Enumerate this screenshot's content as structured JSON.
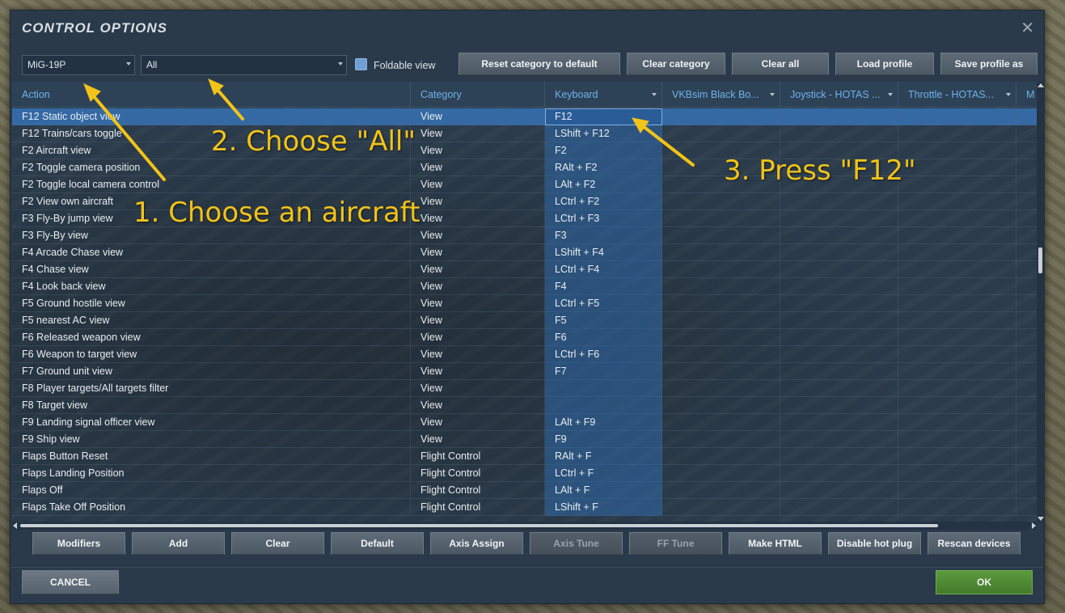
{
  "window": {
    "title": "CONTROL OPTIONS",
    "close_glyph": "✕"
  },
  "toolbar": {
    "aircraft_value": "MiG-19P",
    "category_value": "All",
    "foldable_label": "Foldable view",
    "buttons": [
      "Reset category to default",
      "Clear category",
      "Clear all",
      "Load profile",
      "Save profile as"
    ]
  },
  "grid": {
    "columns": [
      "Action",
      "Category",
      "Keyboard",
      "VKBsim Black Bo...",
      "Joystick - HOTAS ...",
      "Throttle - HOTAS...",
      "M"
    ],
    "rows": [
      {
        "action": "F12 Static object view",
        "category": "View",
        "keyboard": "F12",
        "selected": true
      },
      {
        "action": "F12 Trains/cars toggle",
        "category": "View",
        "keyboard": "LShift + F12"
      },
      {
        "action": "F2 Aircraft view",
        "category": "View",
        "keyboard": "F2"
      },
      {
        "action": "F2 Toggle camera position",
        "category": "View",
        "keyboard": "RAlt + F2"
      },
      {
        "action": "F2 Toggle local camera control",
        "category": "View",
        "keyboard": "LAlt + F2"
      },
      {
        "action": "F2 View own aircraft",
        "category": "View",
        "keyboard": "LCtrl + F2"
      },
      {
        "action": "F3 Fly-By jump view",
        "category": "View",
        "keyboard": "LCtrl + F3"
      },
      {
        "action": "F3 Fly-By view",
        "category": "View",
        "keyboard": "F3"
      },
      {
        "action": "F4 Arcade Chase view",
        "category": "View",
        "keyboard": "LShift + F4"
      },
      {
        "action": "F4 Chase view",
        "category": "View",
        "keyboard": "LCtrl + F4"
      },
      {
        "action": "F4 Look back view",
        "category": "View",
        "keyboard": "F4"
      },
      {
        "action": "F5 Ground hostile view",
        "category": "View",
        "keyboard": "LCtrl + F5"
      },
      {
        "action": "F5 nearest AC view",
        "category": "View",
        "keyboard": "F5"
      },
      {
        "action": "F6 Released weapon view",
        "category": "View",
        "keyboard": "F6"
      },
      {
        "action": "F6 Weapon to target view",
        "category": "View",
        "keyboard": "LCtrl + F6"
      },
      {
        "action": "F7 Ground unit view",
        "category": "View",
        "keyboard": "F7"
      },
      {
        "action": "F8 Player targets/All targets filter",
        "category": "View",
        "keyboard": ""
      },
      {
        "action": "F8 Target view",
        "category": "View",
        "keyboard": ""
      },
      {
        "action": "F9 Landing signal officer view",
        "category": "View",
        "keyboard": "LAlt + F9"
      },
      {
        "action": "F9 Ship view",
        "category": "View",
        "keyboard": "F9"
      },
      {
        "action": "Flaps Button Reset",
        "category": "Flight Control",
        "keyboard": "RAlt + F"
      },
      {
        "action": "Flaps Landing Position",
        "category": "Flight Control",
        "keyboard": "LCtrl + F"
      },
      {
        "action": "Flaps Off",
        "category": "Flight Control",
        "keyboard": "LAlt + F"
      },
      {
        "action": "Flaps Take Off Position",
        "category": "Flight Control",
        "keyboard": "LShift + F"
      }
    ]
  },
  "bottom_buttons": [
    "Modifiers",
    "Add",
    "Clear",
    "Default",
    "Axis Assign",
    "Axis Tune",
    "FF Tune",
    "Make HTML",
    "Disable hot plug",
    "Rescan devices"
  ],
  "bottom_disabled": [
    "Axis Tune",
    "FF Tune"
  ],
  "footer": {
    "cancel_label": "CANCEL",
    "ok_label": "OK"
  },
  "annotations": {
    "step1": "1. Choose an aircraft",
    "step2": "2. Choose \"All\"",
    "step3": "3. Press \"F12\"",
    "color": "#f2c318"
  },
  "colors": {
    "accent_header": "#6fb2e8",
    "selected_row": "#3569a4",
    "ok_green": "#5a9a3c"
  }
}
